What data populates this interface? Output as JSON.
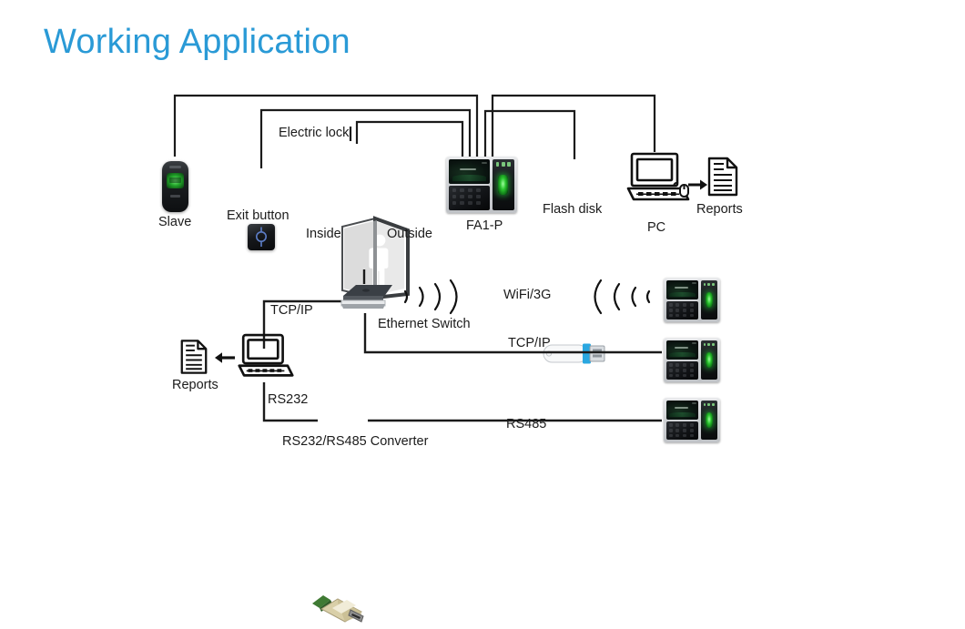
{
  "page": {
    "title": "Working Application",
    "title_color": "#2a9ad6",
    "background": "#ffffff"
  },
  "diagram": {
    "type": "network-topology",
    "top_section": {
      "name": "Access control wiring",
      "nodes": [
        {
          "id": "slave",
          "label": "Slave",
          "icon": "fingerprint-reader-icon"
        },
        {
          "id": "exit-button",
          "label": "Exit button",
          "icon": "exit-button-icon"
        },
        {
          "id": "electric-lock",
          "label": "Electric lock",
          "icon": "lock-callout-icon"
        },
        {
          "id": "door",
          "label": "",
          "icon": "door-icon"
        },
        {
          "id": "door-inside",
          "label": "Inside",
          "icon": "text-only"
        },
        {
          "id": "door-outside",
          "label": "Outside",
          "icon": "text-only"
        },
        {
          "id": "fa1p",
          "label": "FA1-P",
          "icon": "fa1p-terminal-icon"
        },
        {
          "id": "flash-disk",
          "label": "Flash disk",
          "icon": "usb-flash-drive-icon"
        },
        {
          "id": "pc",
          "label": "PC",
          "icon": "desktop-computer-icon"
        },
        {
          "id": "reports-top",
          "label": "Reports",
          "icon": "document-icon"
        }
      ]
    },
    "bottom_section": {
      "name": "Communication methods",
      "nodes": [
        {
          "id": "reports-bottom",
          "label": "Reports",
          "icon": "document-icon"
        },
        {
          "id": "server-pc",
          "label": "",
          "icon": "desktop-computer-icon"
        },
        {
          "id": "ethernet-switch",
          "label": "Ethernet Switch",
          "icon": "router-switch-icon"
        },
        {
          "id": "converter",
          "label": "RS232/RS485 Converter",
          "icon": "serial-converter-icon"
        },
        {
          "id": "terminal-wifi",
          "label": "",
          "icon": "fa1p-terminal-icon"
        },
        {
          "id": "terminal-tcp",
          "label": "",
          "icon": "fa1p-terminal-icon"
        },
        {
          "id": "terminal-rs485",
          "label": "",
          "icon": "fa1p-terminal-icon"
        }
      ],
      "link_labels": [
        {
          "id": "tcpip-left",
          "label": "TCP/IP"
        },
        {
          "id": "rs232",
          "label": "RS232"
        },
        {
          "id": "wifi3g",
          "label": "WiFi/3G"
        },
        {
          "id": "tcpip-right",
          "label": "TCP/IP"
        },
        {
          "id": "rs485",
          "label": "RS485"
        }
      ]
    },
    "line_color": "#1b1b1b"
  }
}
